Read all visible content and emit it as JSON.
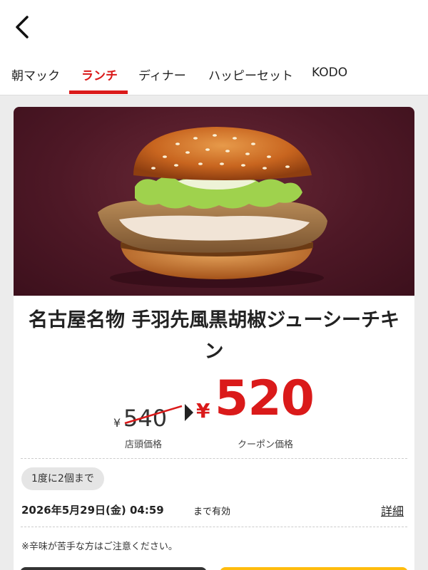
{
  "nav": {
    "back_icon": "chevron-left-icon"
  },
  "tabs": [
    {
      "label": "朝マック",
      "active": false
    },
    {
      "label": "ランチ",
      "active": true
    },
    {
      "label": "ディナー",
      "active": false
    },
    {
      "label": "ハッピーセット",
      "active": false
    },
    {
      "label": "KODO",
      "active": false
    }
  ],
  "colors": {
    "accent": "#da1a1a",
    "hero_bg": "#4e1826",
    "page_bg": "#ececec",
    "yellow": "#ffbc0d"
  },
  "coupon": {
    "image_icon": "burger-image",
    "title": "名古屋名物 手羽先風黒胡椒ジューシーチキン",
    "regular_currency": "¥",
    "regular_price": "540",
    "regular_label": "店頭価格",
    "coupon_currency": "¥",
    "coupon_price": "520",
    "coupon_label": "クーポン価格",
    "limit": "1度に2個まで",
    "expiry": "2026年5月29日(金) 04:59",
    "expiry_suffix": "まで有効",
    "detail_link": "詳細",
    "notice": "※辛味が苦手な方はご注意ください。"
  }
}
